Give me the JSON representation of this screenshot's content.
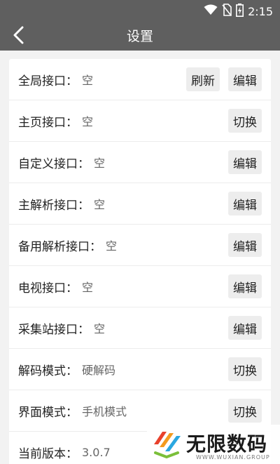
{
  "status_bar": {
    "time": "2:15"
  },
  "header": {
    "title": "设置"
  },
  "rows": [
    {
      "label": "全局接口：",
      "value": "空",
      "actions": [
        "刷新",
        "编辑"
      ]
    },
    {
      "label": "主页接口：",
      "value": "空",
      "actions": [
        "切换"
      ]
    },
    {
      "label": "自定义接口：",
      "value": "空",
      "actions": [
        "编辑"
      ]
    },
    {
      "label": "主解析接口：",
      "value": "空",
      "actions": [
        "编辑"
      ]
    },
    {
      "label": "备用解析接口：",
      "value": "空",
      "actions": [
        "编辑"
      ]
    },
    {
      "label": "电视接口：",
      "value": "空",
      "actions": [
        "编辑"
      ]
    },
    {
      "label": "采集站接口：",
      "value": "空",
      "actions": [
        "编辑"
      ]
    },
    {
      "label": "解码模式：",
      "value": "硬解码",
      "actions": [
        "切换"
      ]
    },
    {
      "label": "界面模式：",
      "value": "手机模式",
      "actions": [
        "切换"
      ]
    },
    {
      "label": "当前版本：",
      "value": "3.0.7",
      "actions": []
    }
  ],
  "watermark": {
    "title": "无限数码",
    "subtitle": "WWW.WUXIAN.GROUP"
  },
  "colors": {
    "bar": "#5f5f5f",
    "background": "#f2f2f2",
    "card": "#ffffff",
    "button": "#ededed"
  },
  "icons": [
    "wifi-icon",
    "no-sim-icon",
    "battery-charging-icon",
    "back-arrow-icon"
  ]
}
